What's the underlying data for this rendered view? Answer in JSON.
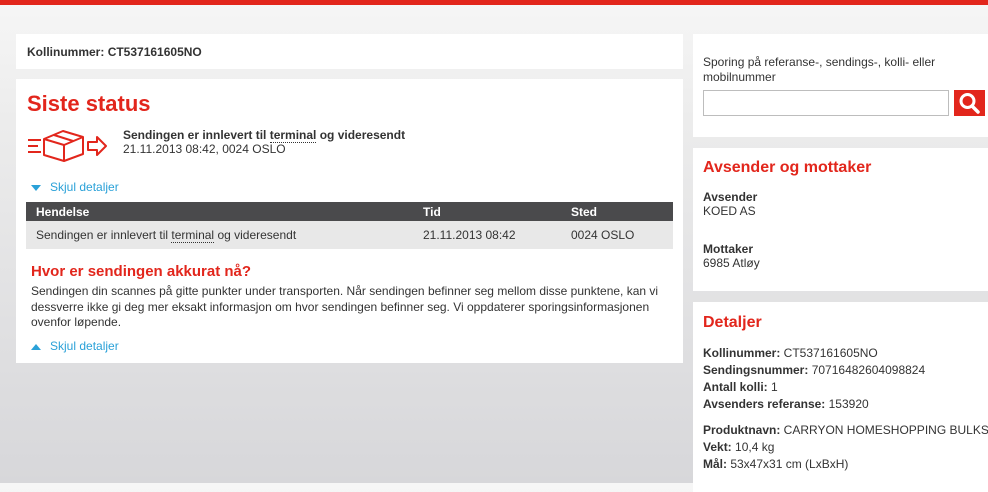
{
  "header_bar_color": "#e2261c",
  "kolli_panel": {
    "label": "Kollinummer:",
    "value": "CT537161605NO"
  },
  "status": {
    "title": "Siste status",
    "event_prefix": "Sendingen er innlevert til ",
    "event_abbr": "terminal",
    "event_suffix": " og videresendt",
    "datetime_place": "21.11.2013 08:42, 0024 OSLO",
    "toggle_label": "Skjul detaljer"
  },
  "events_table": {
    "headers": [
      "Hendelse",
      "Tid",
      "Sted"
    ],
    "rows": [
      {
        "event_prefix": "Sendingen er innlevert til ",
        "event_abbr": "terminal",
        "event_suffix": " og videresendt",
        "time": "21.11.2013 08:42",
        "place": "0024 OSLO"
      }
    ]
  },
  "where": {
    "title": "Hvor er sendingen akkurat nå?",
    "text": "Sendingen din scannes på gitte punkter under transporten. Når sendingen befinner seg mellom disse punktene, kan vi dessverre ikke gi deg mer eksakt informasjon om hvor sendingen befinner seg. Vi oppdaterer sporingsinformasjonen ovenfor løpende.",
    "toggle_label": "Skjul detaljer"
  },
  "search": {
    "label": "Sporing på referanse-, sendings-, kolli- eller mobilnummer",
    "placeholder": "",
    "button_icon": "search-icon"
  },
  "parties": {
    "title": "Avsender og mottaker",
    "sender_label": "Avsender",
    "sender_value": "KOED AS",
    "receiver_label": "Mottaker",
    "receiver_value": "6985 Atløy"
  },
  "details": {
    "title": "Detaljer",
    "kolli_label": "Kollinummer:",
    "kolli_value": " CT537161605NO",
    "sending_label": "Sendingsnummer:",
    "sending_value": " 70716482604098824",
    "antall_label": "Antall kolli:",
    "antall_value": " 1",
    "ref_label": "Avsenders referanse:",
    "ref_value": " 153920",
    "produkt_label": "Produktnavn:",
    "produkt_value": " CARRYON HOMESHOPPING BULKSPLIT",
    "vekt_label": "Vekt:",
    "vekt_value": " 10,4 kg",
    "maal_label": "Mål:",
    "maal_value": " 53x47x31 cm (LxBxH)"
  }
}
